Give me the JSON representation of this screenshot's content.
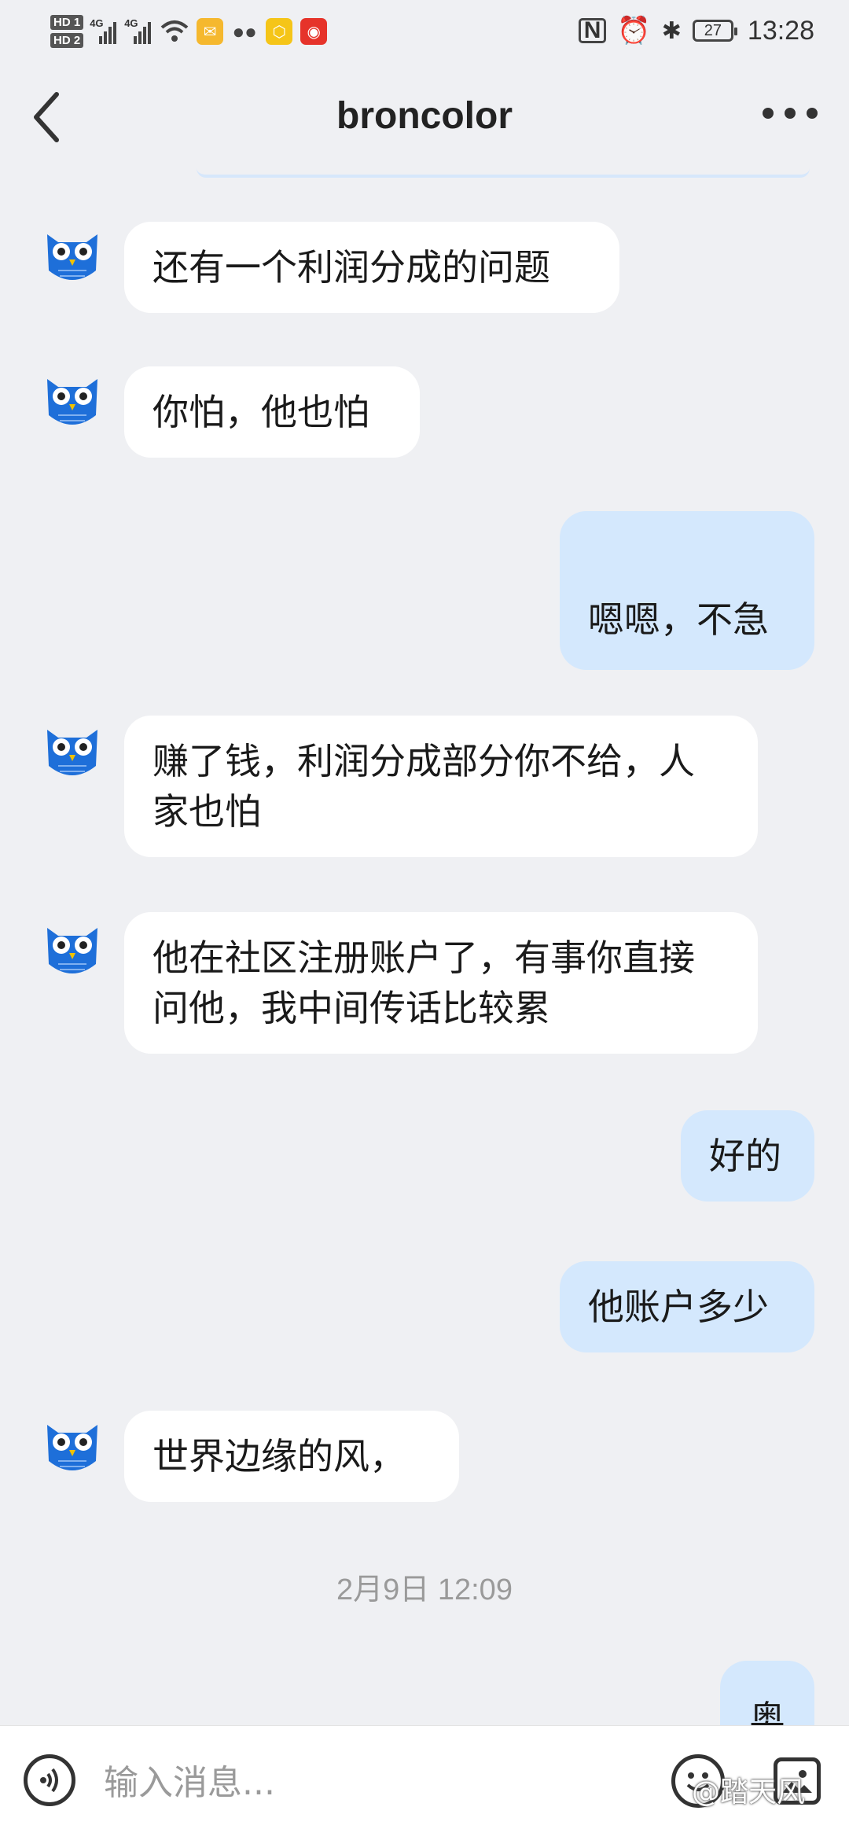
{
  "status_bar": {
    "hd1": "HD 1",
    "hd2": "HD 2",
    "network1": "4G",
    "network2": "4G",
    "battery": "27",
    "time": "13:28"
  },
  "header": {
    "title": "broncolor"
  },
  "messages": [
    {
      "side": "incoming",
      "text": "还有一个利润分成的问题"
    },
    {
      "side": "incoming",
      "text": "你怕，他也怕"
    },
    {
      "side": "outgoing",
      "text": "嗯嗯，不急"
    },
    {
      "side": "incoming",
      "text": "赚了钱，利润分成部分你不给，人家也怕"
    },
    {
      "side": "incoming",
      "text": "他在社区注册账户了，有事你直接问他，我中间传话比较累"
    },
    {
      "side": "outgoing",
      "text": "好的"
    },
    {
      "side": "outgoing",
      "text": "他账户多少"
    },
    {
      "side": "incoming",
      "text": "世界边缘的风，"
    },
    {
      "side": "outgoing",
      "text": "奥"
    }
  ],
  "timestamp": "2月9日 12:09",
  "input_bar": {
    "placeholder": "输入消息..."
  },
  "watermark": "@踏天风",
  "colors": {
    "background": "#eff0f3",
    "incoming_bubble": "#ffffff",
    "outgoing_bubble": "#d4e8fd",
    "avatar_blue": "#1e6fd9"
  }
}
